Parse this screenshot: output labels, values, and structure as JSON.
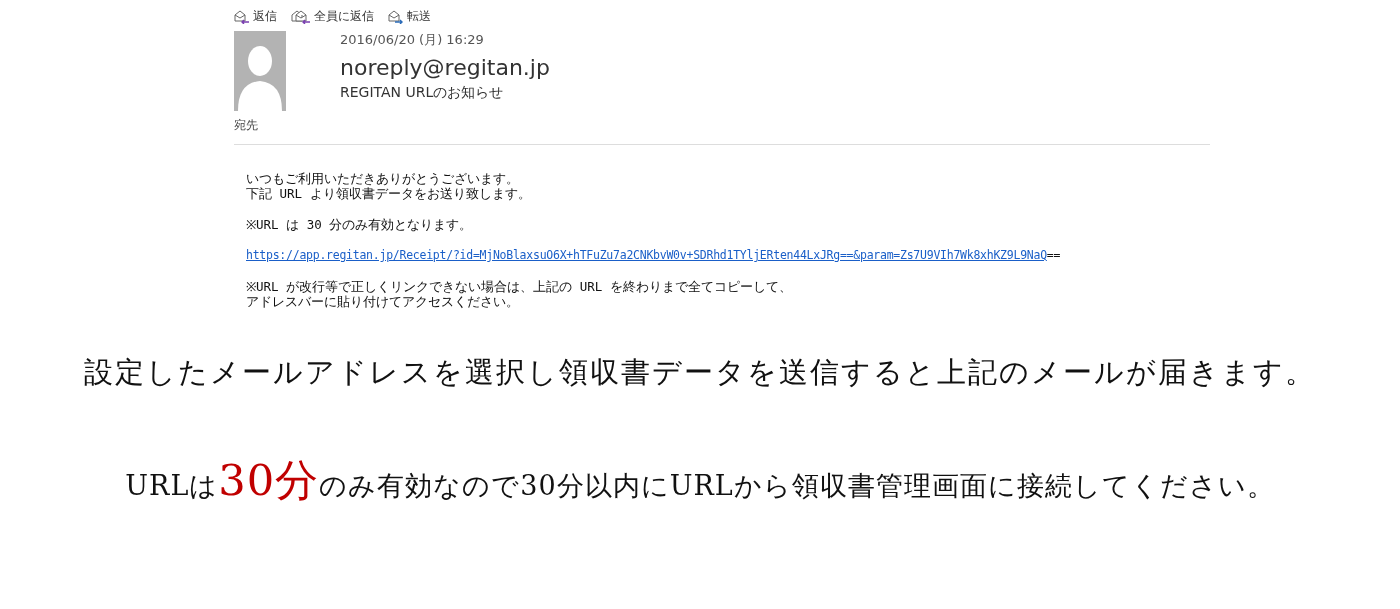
{
  "toolbar": [
    {
      "kind": "reply",
      "label": "返信"
    },
    {
      "kind": "reply-all",
      "label": "全員に返信"
    },
    {
      "kind": "forward",
      "label": "転送"
    }
  ],
  "message": {
    "date": "2016/06/20 (月) 16:29",
    "sender": "noreply@regitan.jp",
    "subject": "REGITAN URLのお知らせ",
    "to_label": "宛先",
    "body": [
      {
        "kind": "text",
        "lines": [
          "いつもご利用いただきありがとうございます。",
          "下記 URL より領収書データをお送り致します。"
        ]
      },
      {
        "kind": "text",
        "lines": [
          "※URL は 30 分のみ有効となります。"
        ]
      },
      {
        "kind": "link",
        "url": "https://app.regitan.jp/Receipt/?id=MjNoBlaxsuO6X+hTFuZu7a2CNKbvW0v+SDRhd1TYljERten44LxJRg==&param=Zs7U9VIh7Wk8xhKZ9L9NaQ",
        "trailing": "=="
      },
      {
        "kind": "text",
        "lines": [
          "※URL が改行等で正しくリンクできない場合は、上記の URL を終わりまで全てコピーして、",
          "アドレスバーに貼り付けてアクセスください。"
        ]
      }
    ]
  },
  "captions": [
    [
      {
        "text": "設定したメールアドレスを選択し領収書データを送信すると上記のメールが届きます。",
        "emphasis": false
      }
    ],
    [
      {
        "text": "URLは",
        "emphasis": false
      },
      {
        "text": "30分",
        "emphasis": true
      },
      {
        "text": "のみ有効なので30分以内にURLから領収書管理画面に接続してください。",
        "emphasis": false
      }
    ]
  ]
}
